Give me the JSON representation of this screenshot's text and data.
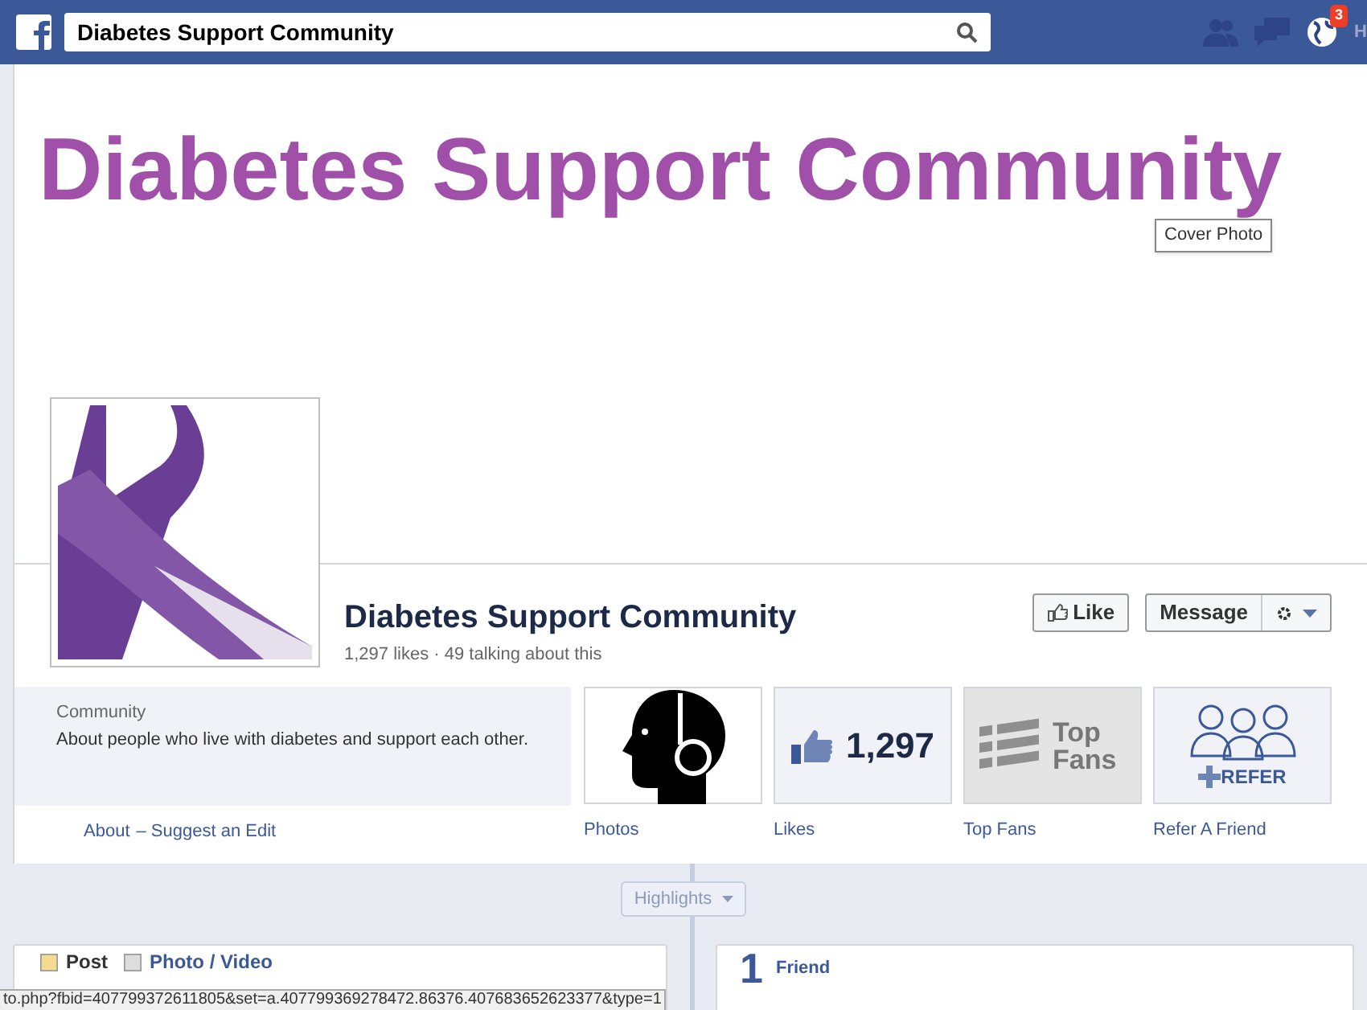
{
  "top_bar": {
    "search": {
      "value": "Diabetes Support Community"
    },
    "notifications": {
      "count": "3"
    },
    "cut_text": "H"
  },
  "cover": {
    "text": "Diabetes Support Community",
    "tooltip": "Cover Photo"
  },
  "page": {
    "name": "Diabetes Support Community",
    "stats": "1,297 likes · 49 talking about this"
  },
  "actions": {
    "like": "Like",
    "message": "Message"
  },
  "about": {
    "category": "Community",
    "description": "About people who live with diabetes and support each other.",
    "links": [
      "About",
      "– Suggest an Edit"
    ]
  },
  "apps": [
    {
      "kind": "photos",
      "label": "Photos"
    },
    {
      "kind": "likes",
      "label": "Likes",
      "count": "1,297"
    },
    {
      "kind": "top_fans",
      "label": "Top Fans",
      "tile_text": "Top Fans"
    },
    {
      "kind": "refer",
      "label": "Refer A Friend",
      "tile_text": "REFER"
    }
  ],
  "timeline": {
    "filter": "Highlights"
  },
  "composer": {
    "tabs": [
      "Post",
      "Photo / Video"
    ]
  },
  "friends": {
    "count": "1",
    "label": "Friend"
  },
  "status_url": "to.php?fbid=407799372611805&set=a.407799369278472.86376.407683652623377&type=1"
}
